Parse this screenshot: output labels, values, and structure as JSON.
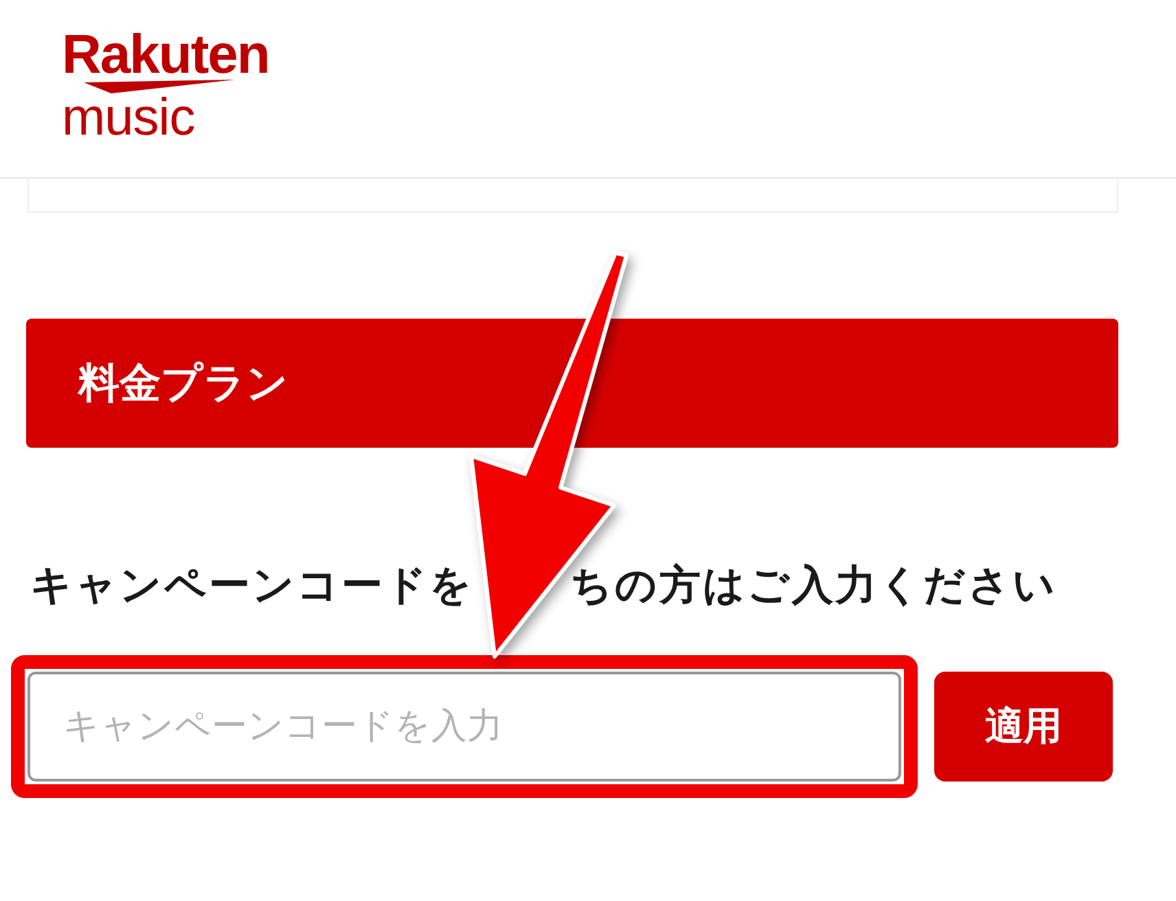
{
  "logo": {
    "brand": "Rakuten",
    "product": "music"
  },
  "plan_bar": {
    "title": "料金プラン"
  },
  "campaign": {
    "heading_parts": [
      "キャンペーンコードを",
      "ちの方はご入力ください"
    ],
    "code_field": {
      "placeholder": "キャンペーンコードを入力",
      "highlighted": true
    },
    "apply_button": "適用"
  }
}
